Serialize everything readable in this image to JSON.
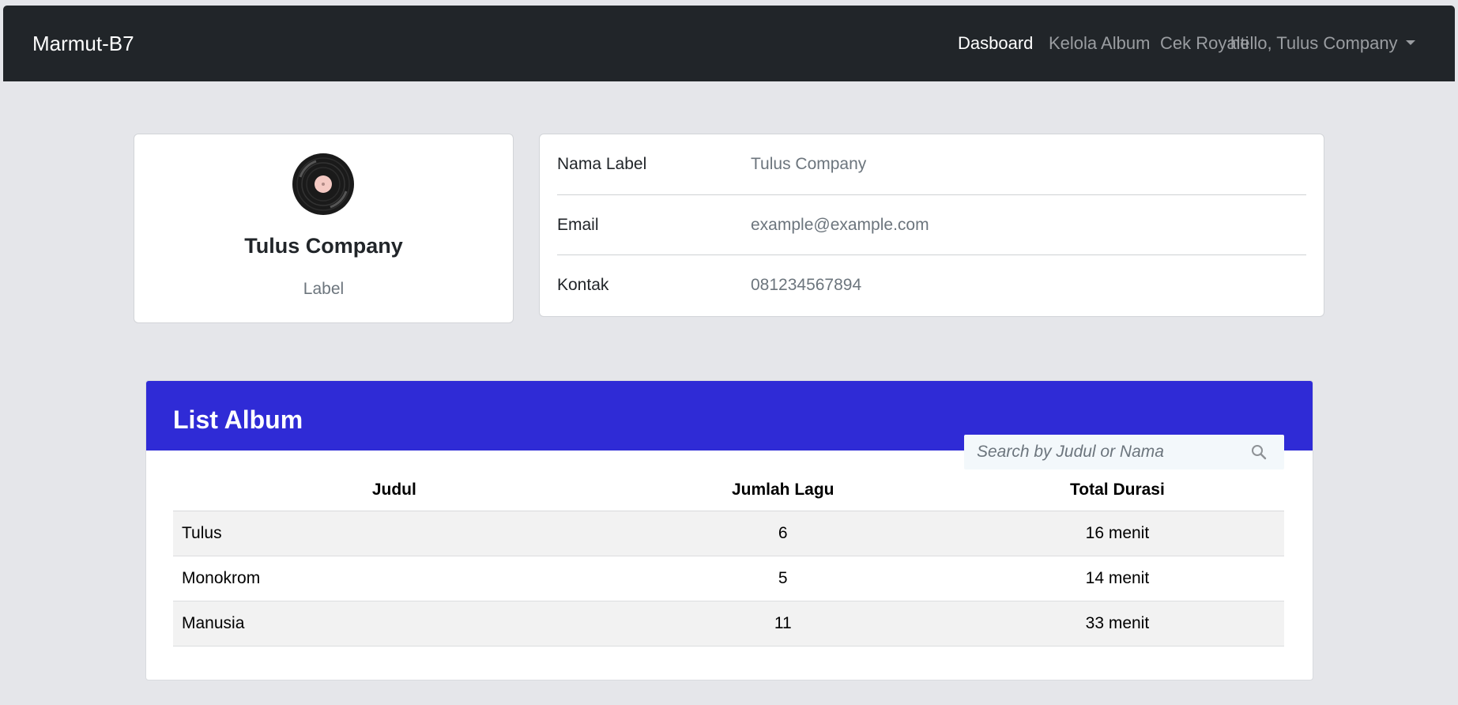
{
  "navbar": {
    "brand": "Marmut-B7",
    "links": [
      {
        "label": "Dasboard",
        "active": true
      },
      {
        "label": "Kelola Album",
        "active": false
      },
      {
        "label": "Cek Royalti",
        "active": false
      }
    ],
    "user_menu": "hello, Tulus Company"
  },
  "profile": {
    "avatar_icon": "vinyl-record-icon",
    "name": "Tulus Company",
    "role": "Label"
  },
  "info": [
    {
      "label": "Nama Label",
      "value": "Tulus Company"
    },
    {
      "label": "Email",
      "value": "example@example.com"
    },
    {
      "label": "Kontak",
      "value": "081234567894"
    }
  ],
  "albums": {
    "title": "List Album",
    "search_placeholder": "Search by Judul or Nama",
    "search_icon": "search-icon",
    "columns": [
      "Judul",
      "Jumlah Lagu",
      "Total Durasi"
    ],
    "rows": [
      [
        "Tulus",
        "6",
        "16 menit"
      ],
      [
        "Monokrom",
        "5",
        "14 menit"
      ],
      [
        "Manusia",
        "11",
        "33 menit"
      ]
    ]
  },
  "colors": {
    "navbar_bg": "#212529",
    "page_bg": "#e5e6ea",
    "album_header_bg": "#2f2bd6"
  }
}
